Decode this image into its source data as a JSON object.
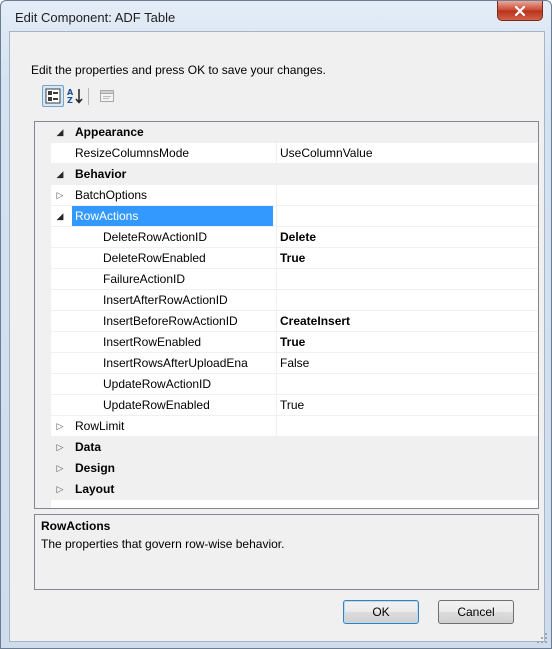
{
  "window": {
    "title": "Edit Component: ADF Table",
    "close_label": "x"
  },
  "instructions": "Edit the properties and press OK to save your changes.",
  "toolbar": {
    "categorized_icon": "categorized-icon",
    "alphabetical_icon": "alphabetical-sort-icon",
    "property_pages_icon": "property-pages-icon"
  },
  "grid": {
    "rows": [
      {
        "name": "Appearance",
        "value": "",
        "type": "category",
        "expander": "open"
      },
      {
        "name": "ResizeColumnsMode",
        "value": "UseColumnValue",
        "type": "property"
      },
      {
        "name": "Behavior",
        "value": "",
        "type": "category",
        "expander": "open"
      },
      {
        "name": "BatchOptions",
        "value": "",
        "type": "property",
        "expander": "closed"
      },
      {
        "name": "RowActions",
        "value": "",
        "type": "property",
        "expander": "open",
        "selected": true
      },
      {
        "name": "DeleteRowActionID",
        "value": "Delete",
        "type": "sub",
        "bold_value": true
      },
      {
        "name": "DeleteRowEnabled",
        "value": "True",
        "type": "sub",
        "bold_value": true
      },
      {
        "name": "FailureActionID",
        "value": "",
        "type": "sub"
      },
      {
        "name": "InsertAfterRowActionID",
        "value": "",
        "type": "sub"
      },
      {
        "name": "InsertBeforeRowActionID",
        "value": "CreateInsert",
        "type": "sub",
        "bold_value": true
      },
      {
        "name": "InsertRowEnabled",
        "value": "True",
        "type": "sub",
        "bold_value": true
      },
      {
        "name": "InsertRowsAfterUploadEna",
        "value": "False",
        "type": "sub"
      },
      {
        "name": "UpdateRowActionID",
        "value": "",
        "type": "sub"
      },
      {
        "name": "UpdateRowEnabled",
        "value": "True",
        "type": "sub"
      },
      {
        "name": "RowLimit",
        "value": "",
        "type": "property",
        "expander": "closed"
      },
      {
        "name": "Data",
        "value": "",
        "type": "category",
        "expander": "closed"
      },
      {
        "name": "Design",
        "value": "",
        "type": "category",
        "expander": "closed"
      },
      {
        "name": "Layout",
        "value": "",
        "type": "category",
        "expander": "closed"
      }
    ]
  },
  "description": {
    "title": "RowActions",
    "text": "The properties that govern row-wise behavior."
  },
  "buttons": {
    "ok": "OK",
    "cancel": "Cancel"
  },
  "colors": {
    "selection": "#3399ff",
    "category_bg": "#f0f0f0",
    "close_button": "#c8452e"
  }
}
